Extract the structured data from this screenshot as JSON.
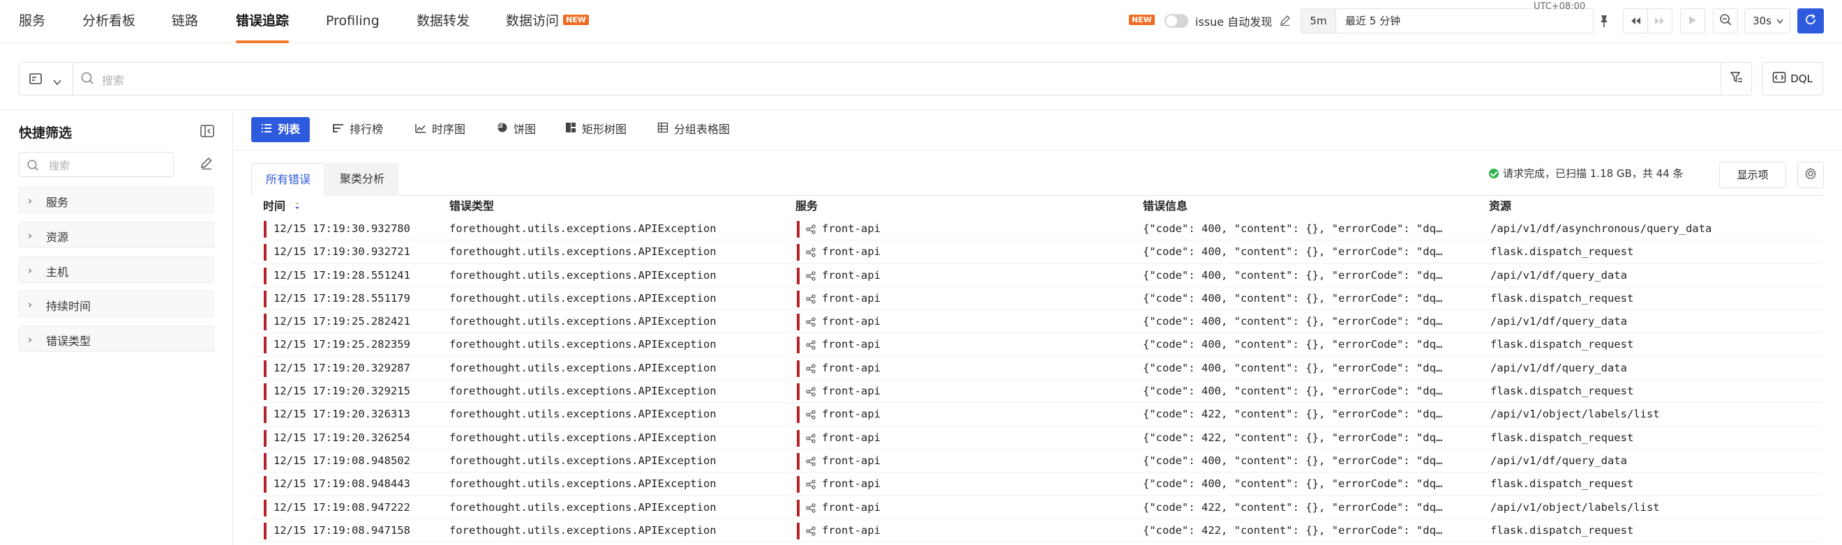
{
  "nav": {
    "items": [
      {
        "label": "服务"
      },
      {
        "label": "分析看板"
      },
      {
        "label": "链路"
      },
      {
        "label": "错误追踪"
      },
      {
        "label": "Profiling"
      },
      {
        "label": "数据转发"
      },
      {
        "label": "数据访问"
      }
    ],
    "active": "错误追踪",
    "new_badge": "NEW"
  },
  "toolbar": {
    "issue_new_badge": "NEW",
    "issue_label": "issue 自动发现",
    "issue_toggle_on": false,
    "time_range_short": "5m",
    "time_range_text": "最近 5 分钟",
    "timezone": "UTC+08:00",
    "refresh_rate": "30s",
    "accent_color": "#2e5bde"
  },
  "search": {
    "placeholder": "搜索",
    "dql_label": "DQL"
  },
  "sidebar": {
    "title": "快捷筛选",
    "search_placeholder": "搜索",
    "facets": [
      {
        "label": "服务"
      },
      {
        "label": "资源"
      },
      {
        "label": "主机"
      },
      {
        "label": "持续时间"
      },
      {
        "label": "错误类型"
      }
    ]
  },
  "view_tabs": [
    {
      "label": "列表",
      "icon": "list-icon"
    },
    {
      "label": "排行榜",
      "icon": "ranking-icon"
    },
    {
      "label": "时序图",
      "icon": "timeseries-icon"
    },
    {
      "label": "饼图",
      "icon": "pie-chart-icon"
    },
    {
      "label": "矩形树图",
      "icon": "treemap-icon"
    },
    {
      "label": "分组表格图",
      "icon": "group-table-icon"
    }
  ],
  "sub_tabs": [
    {
      "label": "所有错误"
    },
    {
      "label": "聚类分析"
    }
  ],
  "status": {
    "text": "请求完成，已扫描 1.18 GB，共 44 条",
    "show_items_label": "显示项"
  },
  "table": {
    "columns": [
      "时间",
      "错误类型",
      "服务",
      "错误信息",
      "资源"
    ],
    "severity_color": "#b4232a",
    "rows": [
      {
        "time": "12/15 17:19:30.932780",
        "type": "forethought.utils.exceptions.APIException",
        "service": "front-api",
        "message": "{\"code\": 400, \"content\": {}, \"errorCode\": \"dq…",
        "resource": "/api/v1/df/asynchronous/query_data"
      },
      {
        "time": "12/15 17:19:30.932721",
        "type": "forethought.utils.exceptions.APIException",
        "service": "front-api",
        "message": "{\"code\": 400, \"content\": {}, \"errorCode\": \"dq…",
        "resource": "flask.dispatch_request"
      },
      {
        "time": "12/15 17:19:28.551241",
        "type": "forethought.utils.exceptions.APIException",
        "service": "front-api",
        "message": "{\"code\": 400, \"content\": {}, \"errorCode\": \"dq…",
        "resource": "/api/v1/df/query_data"
      },
      {
        "time": "12/15 17:19:28.551179",
        "type": "forethought.utils.exceptions.APIException",
        "service": "front-api",
        "message": "{\"code\": 400, \"content\": {}, \"errorCode\": \"dq…",
        "resource": "flask.dispatch_request"
      },
      {
        "time": "12/15 17:19:25.282421",
        "type": "forethought.utils.exceptions.APIException",
        "service": "front-api",
        "message": "{\"code\": 400, \"content\": {}, \"errorCode\": \"dq…",
        "resource": "/api/v1/df/query_data"
      },
      {
        "time": "12/15 17:19:25.282359",
        "type": "forethought.utils.exceptions.APIException",
        "service": "front-api",
        "message": "{\"code\": 400, \"content\": {}, \"errorCode\": \"dq…",
        "resource": "flask.dispatch_request"
      },
      {
        "time": "12/15 17:19:20.329287",
        "type": "forethought.utils.exceptions.APIException",
        "service": "front-api",
        "message": "{\"code\": 400, \"content\": {}, \"errorCode\": \"dq…",
        "resource": "/api/v1/df/query_data"
      },
      {
        "time": "12/15 17:19:20.329215",
        "type": "forethought.utils.exceptions.APIException",
        "service": "front-api",
        "message": "{\"code\": 400, \"content\": {}, \"errorCode\": \"dq…",
        "resource": "flask.dispatch_request"
      },
      {
        "time": "12/15 17:19:20.326313",
        "type": "forethought.utils.exceptions.APIException",
        "service": "front-api",
        "message": "{\"code\": 422, \"content\": {}, \"errorCode\": \"dq…",
        "resource": "/api/v1/object/labels/list"
      },
      {
        "time": "12/15 17:19:20.326254",
        "type": "forethought.utils.exceptions.APIException",
        "service": "front-api",
        "message": "{\"code\": 422, \"content\": {}, \"errorCode\": \"dq…",
        "resource": "flask.dispatch_request"
      },
      {
        "time": "12/15 17:19:08.948502",
        "type": "forethought.utils.exceptions.APIException",
        "service": "front-api",
        "message": "{\"code\": 400, \"content\": {}, \"errorCode\": \"dq…",
        "resource": "/api/v1/df/query_data"
      },
      {
        "time": "12/15 17:19:08.948443",
        "type": "forethought.utils.exceptions.APIException",
        "service": "front-api",
        "message": "{\"code\": 400, \"content\": {}, \"errorCode\": \"dq…",
        "resource": "flask.dispatch_request"
      },
      {
        "time": "12/15 17:19:08.947222",
        "type": "forethought.utils.exceptions.APIException",
        "service": "front-api",
        "message": "{\"code\": 422, \"content\": {}, \"errorCode\": \"dq…",
        "resource": "/api/v1/object/labels/list"
      },
      {
        "time": "12/15 17:19:08.947158",
        "type": "forethought.utils.exceptions.APIException",
        "service": "front-api",
        "message": "{\"code\": 422, \"content\": {}, \"errorCode\": \"dq…",
        "resource": "flask.dispatch_request"
      }
    ]
  }
}
